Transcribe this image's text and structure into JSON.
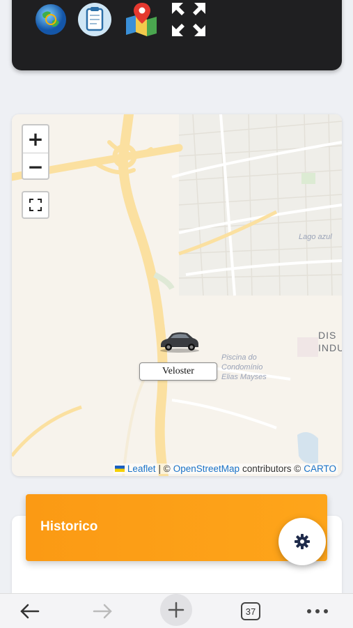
{
  "toolbar": {
    "icons": [
      "globe-icon",
      "clipboard-icon",
      "map-pin-icon",
      "expand-icon"
    ]
  },
  "map": {
    "zoom_in": "+",
    "zoom_out": "−",
    "labels": {
      "lake": "Lago azul",
      "district": "DIS\nINDU",
      "pool": "Piscina do\nCondomínio\nElias Mayses"
    },
    "marker_label": "Veloster",
    "attribution": {
      "leaflet": "Leaflet",
      "sep": "| ©",
      "osm": "OpenStreetMap",
      "contrib": "contributors ©",
      "carto": "CARTO"
    }
  },
  "history": {
    "title": "Historico"
  },
  "browser_nav": {
    "tabs_count": "37"
  },
  "colors": {
    "accent": "#fb9a14",
    "link": "#1a73c8",
    "road": "#fbe0a0"
  }
}
